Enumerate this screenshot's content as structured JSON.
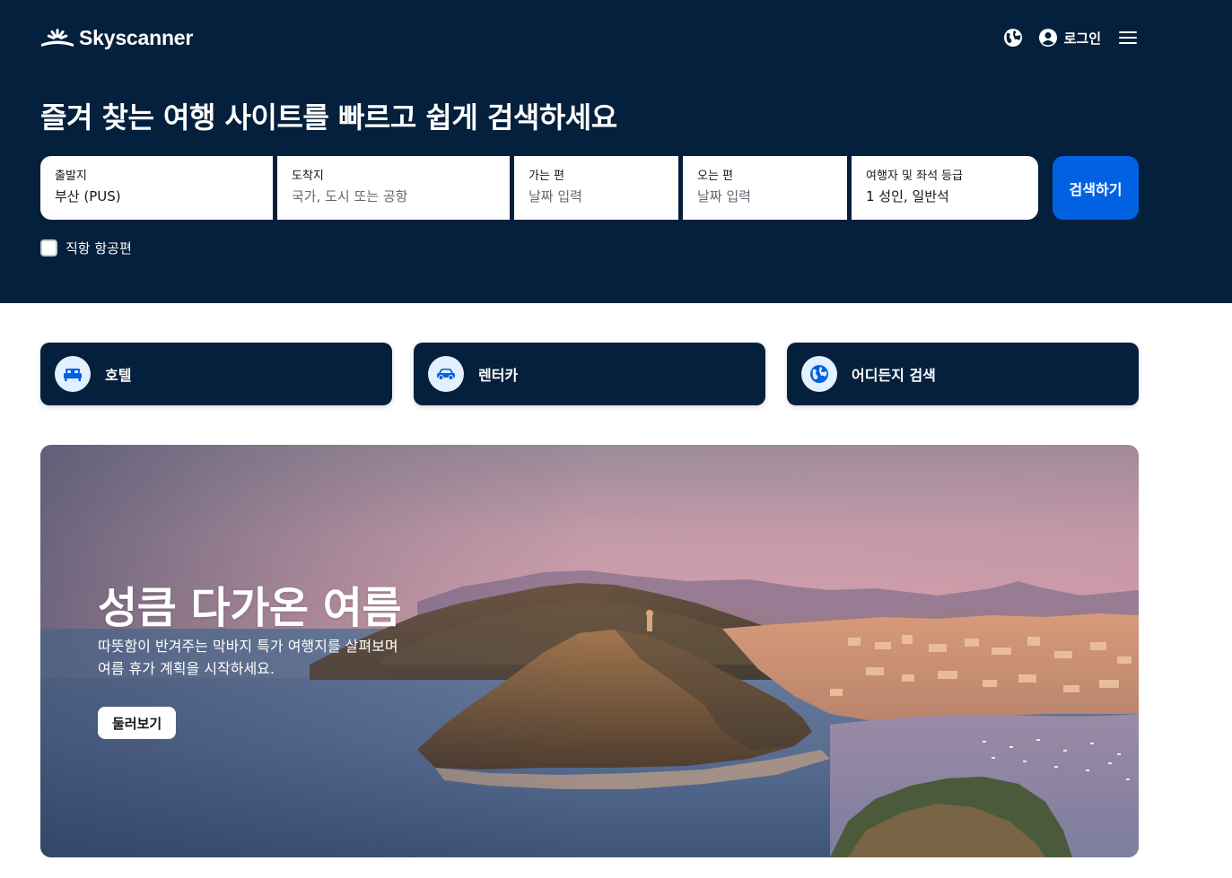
{
  "brand": {
    "name": "Skyscanner"
  },
  "nav": {
    "login_label": "로그인"
  },
  "headline": "즐겨 찾는 여행 사이트를 빠르고 쉽게 검색하세요",
  "search": {
    "origin": {
      "label": "출발지",
      "value": "부산 (PUS)"
    },
    "destination": {
      "label": "도착지",
      "placeholder": "국가, 도시 또는 공항"
    },
    "depart": {
      "label": "가는 편",
      "placeholder": "날짜 입력"
    },
    "return": {
      "label": "오는 편",
      "placeholder": "날짜 입력"
    },
    "travellers": {
      "label": "여행자 및 좌석 등급",
      "value": "1 성인, 일반석"
    },
    "button_label": "검색하기",
    "direct_label": "직항 항공편",
    "direct_checked": false
  },
  "quick_links": [
    {
      "label": "호텔",
      "icon": "bed-icon"
    },
    {
      "label": "렌터카",
      "icon": "car-icon"
    },
    {
      "label": "어디든지 검색",
      "icon": "globe-icon"
    }
  ],
  "hero": {
    "title": "성큼 다가온 여름",
    "subtitle_lines": [
      "따뜻함이 반겨주는 막바지 특가 여행지를 살펴보며",
      "여름 휴가 계획을 시작하세요."
    ],
    "button_label": "둘러보기"
  },
  "colors": {
    "header_bg": "#05203c",
    "primary": "#0062e3",
    "icon_bg": "#e3f0ff"
  }
}
